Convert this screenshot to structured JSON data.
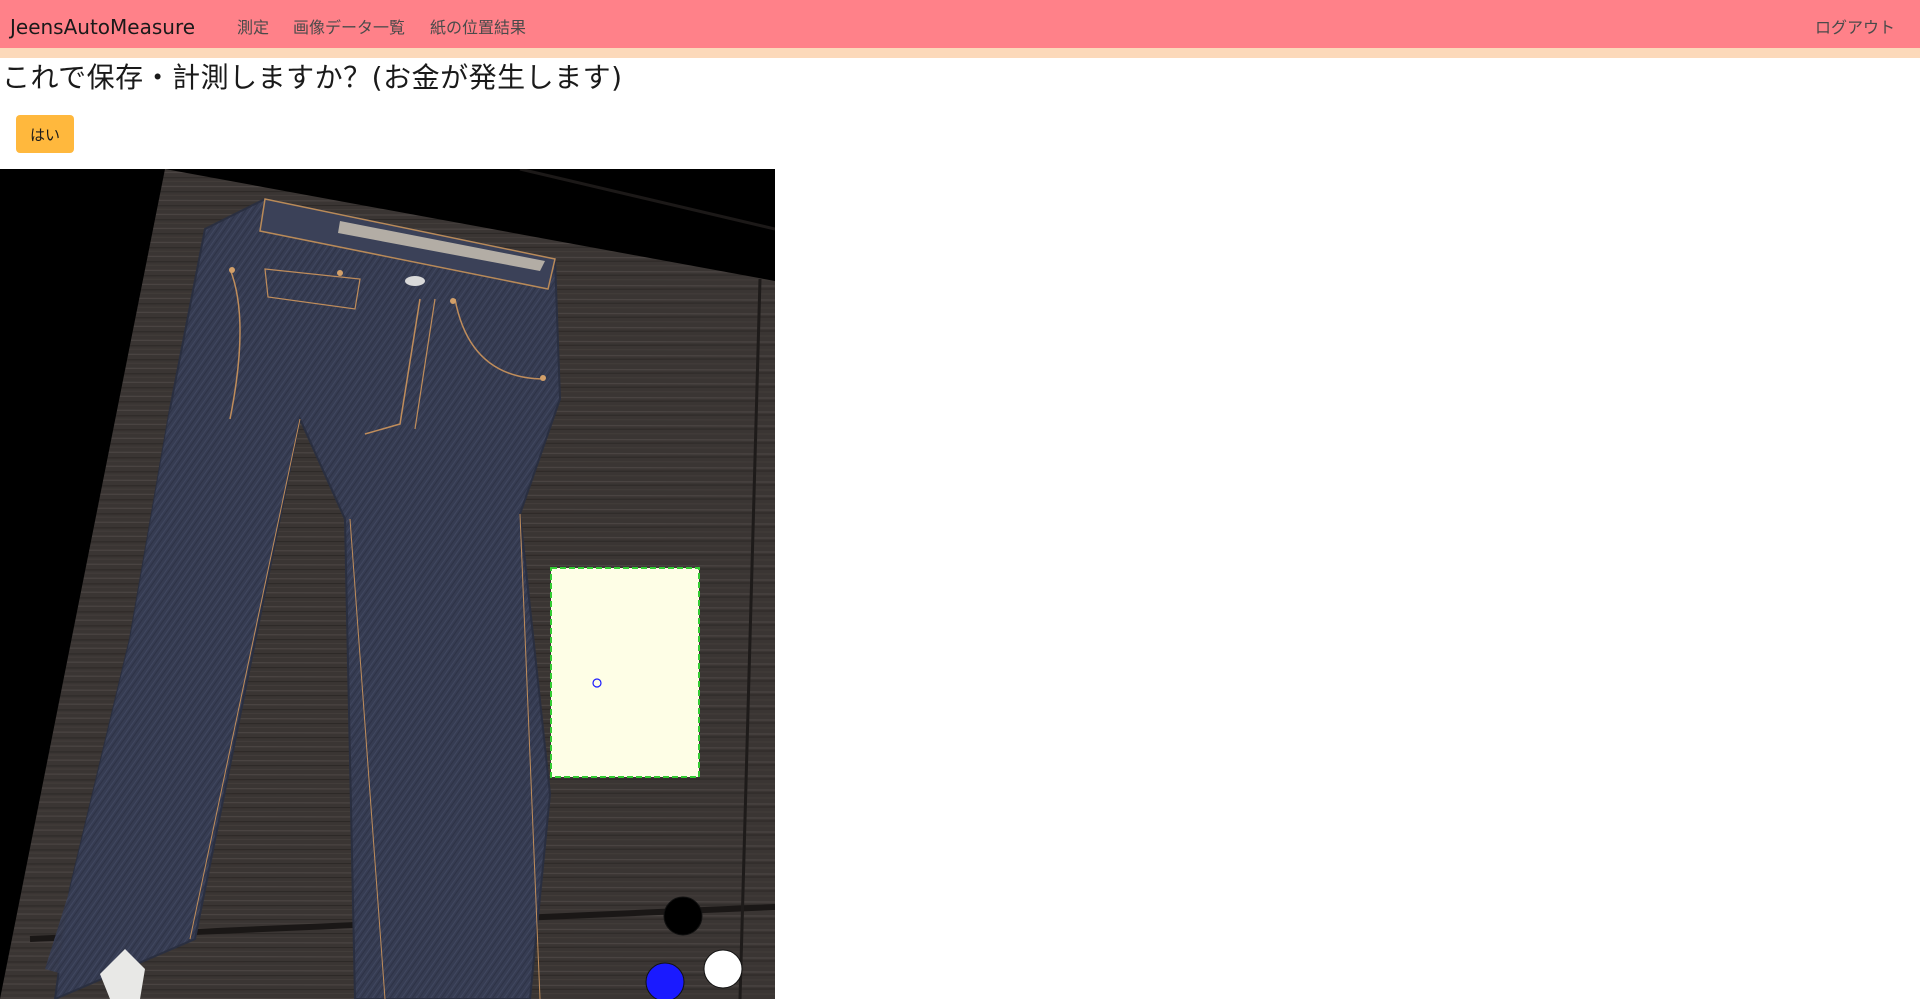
{
  "navbar": {
    "brand": "JeensAutoMeasure",
    "links": [
      "測定",
      "画像データ一覧",
      "紙の位置結果"
    ],
    "logout": "ログアウト",
    "bg_color": "#ff8189",
    "stripe_color": "#fcd9ba"
  },
  "main": {
    "title": "これで保存・計測しますか？(お金が発生します)",
    "confirm_button": "はい",
    "button_color": "#ffb83d"
  },
  "image": {
    "subject": "jeans-photo",
    "paper_marker_color": "#33cc33",
    "handle_colors": [
      "#000000",
      "#1a1aff",
      "#ffffff"
    ]
  }
}
